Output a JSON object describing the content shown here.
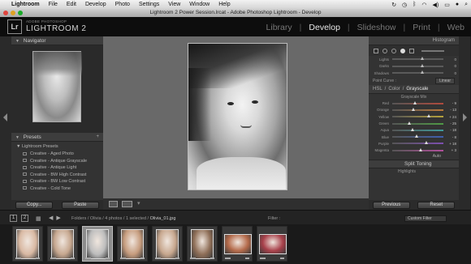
{
  "menubar": {
    "apple": "",
    "items": [
      "Lightroom",
      "File",
      "Edit",
      "Develop",
      "Photo",
      "Settings",
      "View",
      "Window",
      "Help"
    ]
  },
  "window": {
    "title": "Lightroom 2 Power Session.lrcat - Adobe Photoshop Lightroom - Develop"
  },
  "identity": {
    "logo": "Lr",
    "subtitle": "ADOBE PHOTOSHOP",
    "product": "LIGHTROOM 2"
  },
  "modules": [
    "Library",
    "Develop",
    "Slideshow",
    "Print",
    "Web"
  ],
  "active_module": "Develop",
  "left_panel": {
    "navigator_label": "Navigator",
    "presets_label": "Presets",
    "preset_folder": "Lightroom Presets",
    "presets": [
      "Creative - Aged Photo",
      "Creative - Antique Grayscale",
      "Creative - Antique Light",
      "Creative - BW High Contrast",
      "Creative - BW Low Contrast",
      "Creative - Cold Tone"
    ],
    "copy_button": "Copy...",
    "paste_button": "Paste"
  },
  "right_panel": {
    "histogram_label": "Histogram",
    "tone_sliders": [
      {
        "label": "Lights",
        "value": "0",
        "pos": 0.55
      },
      {
        "label": "Darks",
        "value": "0",
        "pos": 0.55
      },
      {
        "label": "Shadows",
        "value": "0",
        "pos": 0.55
      }
    ],
    "point_curve_label": "Point Curve :",
    "point_curve_value": "Linear",
    "hsl_tabs": [
      "HSL",
      "/",
      "Color",
      "/",
      "Grayscale"
    ],
    "mix_title": "Grayscale Mix",
    "mix": [
      {
        "label": "Red",
        "value": "- 9",
        "pos": 0.42,
        "color": "#b04a3c"
      },
      {
        "label": "Orange",
        "value": "- 13",
        "pos": 0.38,
        "color": "#b8783a"
      },
      {
        "label": "Yellow",
        "value": "+ 24",
        "pos": 0.68,
        "color": "#b6a33c"
      },
      {
        "label": "Green",
        "value": "- 25",
        "pos": 0.3,
        "color": "#4f9a45"
      },
      {
        "label": "Aqua",
        "value": "- 18",
        "pos": 0.36,
        "color": "#3f9a9a"
      },
      {
        "label": "Blue",
        "value": "- 8",
        "pos": 0.45,
        "color": "#3f5fb0"
      },
      {
        "label": "Purple",
        "value": "+ 18",
        "pos": 0.63,
        "color": "#7c4fb0"
      },
      {
        "label": "Magenta",
        "value": "+ 3",
        "pos": 0.52,
        "color": "#b04f9a"
      }
    ],
    "auto_label": "Auto",
    "split_toning_label": "Split Toning",
    "hue_label": "Highlights",
    "previous_button": "Previous",
    "reset_button": "Reset"
  },
  "filmstrip_header": {
    "screen1": "1",
    "screen2": "2",
    "path_prefix": "Folders / Olivia / 4 photos / 1 selected /",
    "filename": "Olivia_01.jpg",
    "filter_label": "Filter :",
    "custom_filter": "Custom Filter"
  },
  "filmstrip": {
    "thumbnails": [
      {
        "selected": false,
        "kind": "tall",
        "tone": "#d9b9a3"
      },
      {
        "selected": false,
        "kind": "tall",
        "tone": "#c6a78f"
      },
      {
        "selected": true,
        "kind": "tall",
        "tone": "#bdbdbd"
      },
      {
        "selected": false,
        "kind": "tall",
        "tone": "#c69c7e"
      },
      {
        "selected": false,
        "kind": "tall",
        "tone": "#c7a78e"
      },
      {
        "selected": false,
        "kind": "tall",
        "tone": "#8f6f58"
      },
      {
        "selected": false,
        "kind": "wide",
        "tone": "#b46a4a"
      },
      {
        "selected": false,
        "kind": "wide",
        "tone": "#a8404a"
      }
    ]
  }
}
